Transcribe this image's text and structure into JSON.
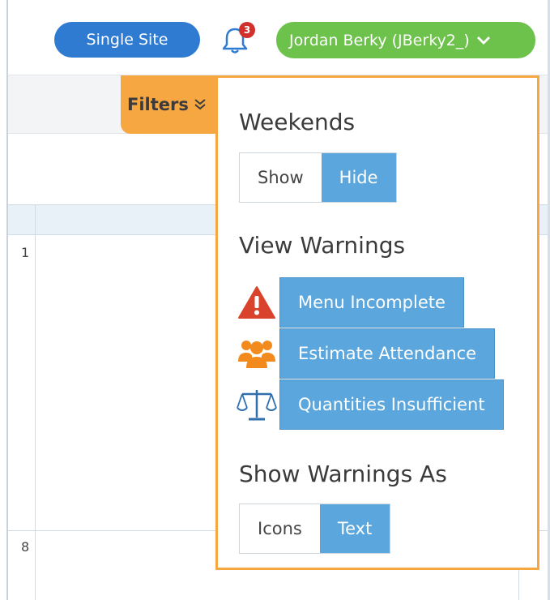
{
  "header": {
    "site_button": "Single Site",
    "notifications_count": "3",
    "user_menu_label": "Jordan Berky (JBerky2_)"
  },
  "toolbar": {
    "filters_label": "Filters"
  },
  "grid": {
    "row_labels": [
      "1",
      "8"
    ]
  },
  "filters_panel": {
    "weekends": {
      "title": "Weekends",
      "options": [
        "Show",
        "Hide"
      ],
      "selected": "Hide"
    },
    "view_warnings": {
      "title": "View Warnings",
      "items": [
        {
          "icon": "warning-triangle-icon",
          "label": "Menu Incomplete",
          "color": "#d9432b"
        },
        {
          "icon": "people-group-icon",
          "label": "Estimate Attendance",
          "color": "#f28a1e"
        },
        {
          "icon": "balance-scale-icon",
          "label": "Quantities Insufficient",
          "color": "#2f6fad"
        }
      ]
    },
    "show_warnings_as": {
      "title": "Show Warnings As",
      "options": [
        "Icons",
        "Text"
      ],
      "selected": "Text"
    }
  },
  "colors": {
    "primary_blue": "#2f7bd1",
    "user_green": "#6cc24a",
    "filters_orange": "#f6a741",
    "active_option": "#5ba6dc",
    "badge_red": "#d0312d"
  }
}
